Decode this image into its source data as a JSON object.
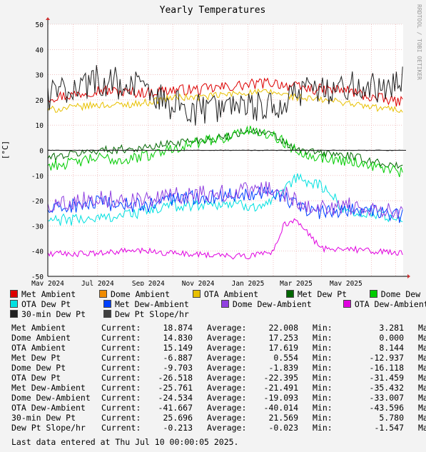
{
  "chart_data": {
    "type": "line",
    "title": "Yearly Temperatures",
    "watermark": "RRDTOOL / TOBI OETIKER",
    "ylabel": "[°C]",
    "ylim": [
      -50,
      50
    ],
    "y_ticks": [
      "50",
      "40",
      "30",
      "20",
      "10",
      "0",
      "-10",
      "-20",
      "-30",
      "-40",
      "-50"
    ],
    "x_ticks": [
      "May 2024",
      "Jul 2024",
      "Sep 2024",
      "Nov 2024",
      "Jan 2025",
      "Mar 2025",
      "May 2025"
    ],
    "x_range": [
      "2024-05-01",
      "2025-07-10"
    ],
    "grid": true,
    "series": [
      {
        "name": "Met Ambient",
        "color": "#dd0000",
        "x": [
          "2024-05-01",
          "2024-06-01",
          "2024-07-01",
          "2024-08-01",
          "2024-09-01",
          "2024-10-01",
          "2024-11-01",
          "2024-12-01",
          "2025-01-01",
          "2025-02-01",
          "2025-03-01",
          "2025-04-01",
          "2025-05-01",
          "2025-06-01",
          "2025-07-10"
        ],
        "values": [
          21,
          22,
          24,
          23,
          23,
          24,
          24,
          25,
          26,
          27,
          25,
          24,
          24,
          21,
          19
        ]
      },
      {
        "name": "Dome Ambient",
        "color": "#f08c00",
        "x": [],
        "values": []
      },
      {
        "name": "OTA Ambient",
        "color": "#e8c000",
        "x": [
          "2024-05-01",
          "2024-06-01",
          "2024-07-01",
          "2024-08-01",
          "2024-09-01",
          "2024-10-01",
          "2024-11-01",
          "2024-12-01",
          "2025-01-01",
          "2025-02-01",
          "2025-03-01",
          "2025-04-01",
          "2025-05-01",
          "2025-06-01",
          "2025-07-10"
        ],
        "values": [
          16,
          17,
          18,
          18,
          19,
          21,
          21,
          22,
          23,
          23,
          21,
          20,
          19,
          17,
          16
        ]
      },
      {
        "name": "Met Dew Pt",
        "color": "#006600",
        "x": [
          "2024-05-01",
          "2024-07-01",
          "2024-09-01",
          "2024-10-01",
          "2024-12-01",
          "2025-01-01",
          "2025-02-01",
          "2025-03-01",
          "2025-05-01",
          "2025-07-10"
        ],
        "values": [
          -3,
          0,
          1,
          3,
          5,
          8,
          6,
          0,
          -2,
          -7
        ]
      },
      {
        "name": "Dome Dew Pt",
        "color": "#00cc00",
        "x": [
          "2024-05-01",
          "2024-06-01",
          "2024-07-01",
          "2024-08-01",
          "2024-09-01",
          "2024-10-01",
          "2024-11-01",
          "2024-12-01",
          "2025-01-01",
          "2025-02-01",
          "2025-03-01",
          "2025-04-01",
          "2025-05-01",
          "2025-06-01",
          "2025-07-10"
        ],
        "values": [
          -6,
          -5,
          -3,
          -4,
          -2,
          1,
          3,
          5,
          8,
          6,
          0,
          -3,
          -4,
          -6,
          -9
        ]
      },
      {
        "name": "OTA Dew Pt",
        "color": "#00e0e0",
        "x": [
          "2024-05-01",
          "2024-07-01",
          "2024-09-01",
          "2024-10-01",
          "2024-12-01",
          "2025-01-01",
          "2025-02-01",
          "2025-03-01",
          "2025-04-01",
          "2025-05-01",
          "2025-07-10"
        ],
        "values": [
          -28,
          -27,
          -24,
          -22,
          -21,
          -22,
          -21,
          -11,
          -14,
          -24,
          -27
        ]
      },
      {
        "name": "Met Dew-Ambient",
        "color": "#0040ff",
        "x": [
          "2024-05-01",
          "2024-06-01",
          "2024-07-01",
          "2024-09-01",
          "2024-10-01",
          "2024-12-01",
          "2025-01-01",
          "2025-02-01",
          "2025-03-01",
          "2025-04-01",
          "2025-05-01",
          "2025-07-10"
        ],
        "values": [
          -24,
          -22,
          -21,
          -22,
          -19,
          -18,
          -17,
          -16,
          -22,
          -25,
          -23,
          -26
        ]
      },
      {
        "name": "Dome Dew-Ambient",
        "color": "#9040e0",
        "x": [
          "2024-05-01",
          "2024-06-01",
          "2024-07-01",
          "2024-09-01",
          "2024-10-01",
          "2024-12-01",
          "2025-01-01",
          "2025-02-01",
          "2025-03-01",
          "2025-04-01",
          "2025-05-01",
          "2025-07-10"
        ],
        "values": [
          -22,
          -20,
          -19,
          -20,
          -18,
          -17,
          -16,
          -15,
          -20,
          -23,
          -22,
          -24
        ]
      },
      {
        "name": "OTA Dew-Ambient",
        "color": "#e000e0",
        "x": [
          "2024-05-01",
          "2024-06-01",
          "2024-07-01",
          "2024-08-01",
          "2024-09-01",
          "2024-10-01",
          "2024-11-01",
          "2024-12-01",
          "2025-01-01",
          "2025-02-01",
          "2025-02-15",
          "2025-03-01",
          "2025-04-01",
          "2025-05-01",
          "2025-06-01",
          "2025-07-10"
        ],
        "values": [
          -41,
          -41,
          -41,
          -40,
          -40,
          -41,
          -41,
          -42,
          -42,
          -40,
          -29,
          -28,
          -39,
          -39,
          -40,
          -41
        ]
      },
      {
        "name": "30-min Dew Pt",
        "color": "#202020",
        "x": [
          "2024-05-01",
          "2024-06-01",
          "2024-07-01",
          "2024-08-01",
          "2024-09-01",
          "2024-10-01",
          "2024-11-01",
          "2024-12-01",
          "2025-01-01",
          "2025-02-01",
          "2025-03-01",
          "2025-04-01",
          "2025-05-01",
          "2025-06-01",
          "2025-07-10"
        ],
        "values": [
          22,
          25,
          28,
          26,
          24,
          18,
          16,
          17,
          16,
          18,
          22,
          24,
          26,
          25,
          27
        ]
      },
      {
        "name": "Dew Pt Slope/hr",
        "color": "#404040",
        "x": [
          "2024-05-01",
          "2024-09-01",
          "2025-01-01",
          "2025-05-01",
          "2025-07-10"
        ],
        "values": [
          0,
          0,
          0,
          0,
          0
        ]
      }
    ]
  },
  "stats": {
    "labels": {
      "current": "Current:",
      "average": "Average:",
      "min": "Min:",
      "max": "Ma"
    },
    "rows": [
      {
        "name": "Met Ambient",
        "current": "18.874",
        "average": "22.008",
        "min": "3.281"
      },
      {
        "name": "Dome Ambient",
        "current": "14.830",
        "average": "17.253",
        "min": "0.000"
      },
      {
        "name": "OTA Ambient",
        "current": "15.149",
        "average": "17.619",
        "min": "8.144"
      },
      {
        "name": "Met Dew Pt",
        "current": "-6.887",
        "average": "0.554",
        "min": "-12.937"
      },
      {
        "name": "Dome Dew Pt",
        "current": "-9.703",
        "average": "-1.839",
        "min": "-16.118"
      },
      {
        "name": "OTA Dew Pt",
        "current": "-26.518",
        "average": "-22.395",
        "min": "-31.459"
      },
      {
        "name": "Met Dew-Ambient",
        "current": "-25.761",
        "average": "-21.491",
        "min": "-35.432"
      },
      {
        "name": "Dome Dew-Ambient",
        "current": "-24.534",
        "average": "-19.093",
        "min": "-33.007"
      },
      {
        "name": "OTA Dew-Ambient",
        "current": "-41.667",
        "average": "-40.014",
        "min": "-43.596"
      },
      {
        "name": "30-min Dew Pt",
        "current": "25.696",
        "average": "21.569",
        "min": "5.780"
      },
      {
        "name": "Dew Pt Slope/hr",
        "current": "-0.213",
        "average": "-0.023",
        "min": "-1.547"
      }
    ]
  },
  "footer": "Last data entered at Thu Jul 10 00:00:05 2025."
}
